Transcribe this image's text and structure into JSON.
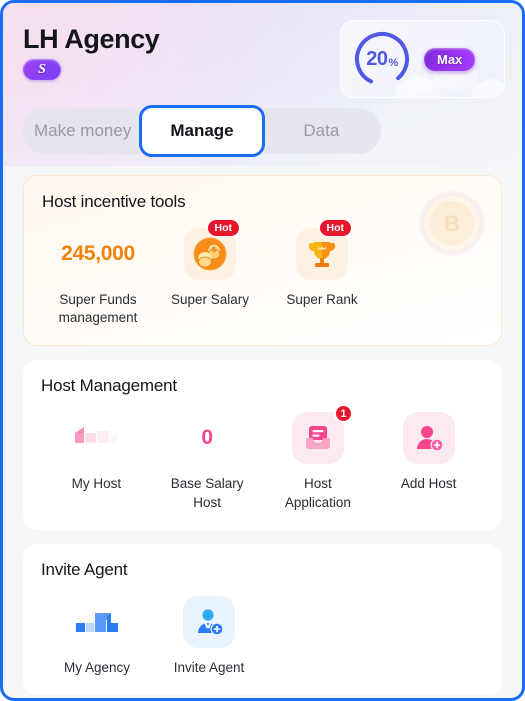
{
  "header": {
    "title": "LH Agency",
    "level_badge": "S",
    "commission": {
      "percent_value": "20",
      "percent_symbol": "%",
      "ring_progress": 20,
      "max_label": "Max",
      "accent_color": "#5158e8",
      "max_pill_color": "#9530ef"
    }
  },
  "tabs": [
    {
      "label": "Make money",
      "active": false
    },
    {
      "label": "Manage",
      "active": true
    },
    {
      "label": "Data",
      "active": false
    }
  ],
  "sections": [
    {
      "id": "host-incentive-tools",
      "title": "Host incentive tools",
      "accent_color": "#f2820c",
      "tiles": [
        {
          "id": "super-funds-management",
          "label": "Super Funds\nmanagement",
          "value": "245,000",
          "icon": "coins-value",
          "badge": null
        },
        {
          "id": "super-salary",
          "label": "Super Salary",
          "value": null,
          "icon": "coin-stack-icon",
          "badge": "Hot"
        },
        {
          "id": "super-rank",
          "label": "Super Rank",
          "value": null,
          "icon": "trophy-icon",
          "badge": "Hot"
        }
      ]
    },
    {
      "id": "host-management",
      "title": "Host Management",
      "accent_color": "#f4468d",
      "tiles": [
        {
          "id": "my-host",
          "label": "My Host",
          "value": null,
          "icon": "bar-chart-pink-icon",
          "badge": null
        },
        {
          "id": "base-salary-host",
          "label": "Base Salary\nHost",
          "value": "0",
          "icon": "number-value",
          "badge": null
        },
        {
          "id": "host-application",
          "label": "Host\nApplication",
          "value": null,
          "icon": "inbox-icon",
          "badge": "1"
        },
        {
          "id": "add-host",
          "label": "Add Host",
          "value": null,
          "icon": "person-add-icon",
          "badge": null
        }
      ]
    },
    {
      "id": "invite-agent",
      "title": "Invite Agent",
      "accent_color": "#2b7df6",
      "tiles": [
        {
          "id": "my-agency",
          "label": "My Agency",
          "value": null,
          "icon": "bar-chart-blue-icon",
          "badge": null
        },
        {
          "id": "invite-agent",
          "label": "Invite Agent",
          "value": null,
          "icon": "agent-add-icon",
          "badge": null
        }
      ]
    }
  ]
}
